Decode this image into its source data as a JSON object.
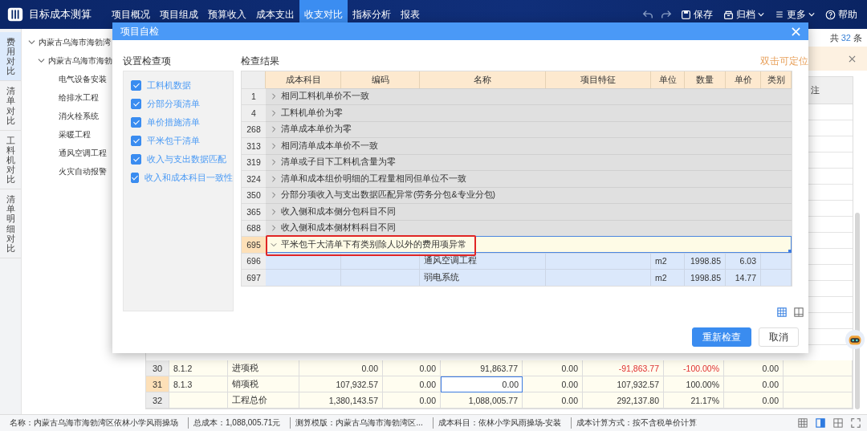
{
  "app_bar": {
    "title": "目标成本测算",
    "nav": [
      {
        "label": "项目概况",
        "selected": false
      },
      {
        "label": "项目组成",
        "selected": false
      },
      {
        "label": "预算收入",
        "selected": false
      },
      {
        "label": "成本支出",
        "selected": false
      },
      {
        "label": "收支对比",
        "selected": true
      },
      {
        "label": "指标分析",
        "selected": false
      },
      {
        "label": "报表",
        "selected": false
      }
    ],
    "actions": [
      {
        "kind": "save",
        "label": "保存",
        "dropdown": false
      },
      {
        "kind": "archive",
        "label": "归档",
        "dropdown": true
      },
      {
        "kind": "more",
        "label": "更多",
        "dropdown": true
      },
      {
        "kind": "help",
        "label": "帮助",
        "dropdown": false
      }
    ]
  },
  "side_tabs": [
    {
      "label": "费用对比",
      "selected": true
    },
    {
      "label": "清单对比",
      "selected": false
    },
    {
      "label": "工料机对比",
      "selected": false
    },
    {
      "label": "清单明细对比",
      "selected": false
    }
  ],
  "tree": [
    {
      "label": "内蒙古乌海市海勃湾",
      "expanded": true,
      "children": [
        {
          "label": "内蒙古乌海市海勃",
          "expanded": true,
          "children": [
            {
              "label": "电气设备安装"
            },
            {
              "label": "给排水工程"
            },
            {
              "label": "消火栓系统"
            },
            {
              "label": "采暖工程"
            },
            {
              "label": "通风空调工程"
            },
            {
              "label": "火灾自动报警"
            }
          ]
        }
      ]
    }
  ],
  "list_summary": {
    "prefix": "共",
    "count": "32",
    "suffix": "条"
  },
  "main_table": {
    "remark_header": "注",
    "rows": [
      {
        "number": "30",
        "selected": false,
        "negative": true,
        "cells": [
          {
            "text": "8.1.2",
            "selected": false
          },
          {
            "text": "进项税",
            "selected": false
          },
          {
            "text": "0.00",
            "selected": false
          },
          {
            "text": "0.00",
            "selected": false
          },
          {
            "text": "91,863.77",
            "selected": false
          },
          {
            "text": "0.00",
            "selected": false
          },
          {
            "text": "-91,863.77",
            "selected": false
          },
          {
            "text": "-100.00%",
            "selected": false
          },
          {
            "text": "0.00",
            "selected": false
          }
        ]
      },
      {
        "number": "31",
        "selected": true,
        "negative": false,
        "cells": [
          {
            "text": "8.1.3",
            "selected": false
          },
          {
            "text": "销项税",
            "selected": false
          },
          {
            "text": "107,932.57",
            "selected": false
          },
          {
            "text": "0.00",
            "selected": false
          },
          {
            "text": "0.00",
            "selected": true
          },
          {
            "text": "0.00",
            "selected": false
          },
          {
            "text": "107,932.57",
            "selected": false
          },
          {
            "text": "100.00%",
            "selected": false
          },
          {
            "text": "0.00",
            "selected": false
          }
        ]
      },
      {
        "number": "32",
        "selected": false,
        "negative": false,
        "cells": [
          {
            "text": "",
            "selected": false
          },
          {
            "text": "工程总价",
            "selected": false
          },
          {
            "text": "1,380,143.57",
            "selected": false
          },
          {
            "text": "0.00",
            "selected": false
          },
          {
            "text": "1,088,005.77",
            "selected": false
          },
          {
            "text": "0.00",
            "selected": false
          },
          {
            "text": "292,137.80",
            "selected": false
          },
          {
            "text": "21.17%",
            "selected": false
          },
          {
            "text": "0.00",
            "selected": false
          }
        ]
      }
    ]
  },
  "status_bar": [
    "名称：内蒙古乌海市海勃湾区依林小学风雨操场",
    "总成本：1,088,005.71元",
    "测算模版：内蒙古乌海市海勃湾区...",
    "成本科目：依林小学风雨操场-安装",
    "成本计算方式：按不含税单价计算"
  ],
  "dialog": {
    "title": "项目自检",
    "settings_title": "设置检查项",
    "checks": [
      {
        "label": "工料机数据",
        "checked": true
      },
      {
        "label": "分部分项清单",
        "checked": true
      },
      {
        "label": "单价措施清单",
        "checked": true
      },
      {
        "label": "平米包干清单",
        "checked": true
      },
      {
        "label": "收入与支出数据匹配",
        "checked": true
      },
      {
        "label": "收入和成本科目一致性",
        "checked": true
      }
    ],
    "results_title": "检查结果",
    "hint": "双击可定位",
    "columns": [
      "成本科目",
      "编码",
      "名称",
      "项目特征",
      "单位",
      "数量",
      "单价",
      "类别"
    ],
    "rows": [
      {
        "kind": "group",
        "number": "1",
        "label": "相同工料机单价不一致",
        "expanded": false,
        "selected": false,
        "annotated": false
      },
      {
        "kind": "group",
        "number": "4",
        "label": "工料机单价为零",
        "expanded": false,
        "selected": false,
        "annotated": false
      },
      {
        "kind": "group",
        "number": "268",
        "label": "清单成本单价为零",
        "expanded": false,
        "selected": false,
        "annotated": false
      },
      {
        "kind": "group",
        "number": "313",
        "label": "相同清单成本单价不一致",
        "expanded": false,
        "selected": false,
        "annotated": false
      },
      {
        "kind": "group",
        "number": "319",
        "label": "清单或子目下工料机含量为零",
        "expanded": false,
        "selected": false,
        "annotated": false
      },
      {
        "kind": "group",
        "number": "324",
        "label": "清单和成本组价明细的工程量相同但单位不一致",
        "expanded": false,
        "selected": false,
        "annotated": false
      },
      {
        "kind": "group",
        "number": "350",
        "label": "分部分项收入与支出数据匹配异常(劳务分包&专业分包)",
        "expanded": false,
        "selected": false,
        "annotated": false
      },
      {
        "kind": "group",
        "number": "365",
        "label": "收入侧和成本侧分包科目不同",
        "expanded": false,
        "selected": false,
        "annotated": false
      },
      {
        "kind": "group",
        "number": "688",
        "label": "收入侧和成本侧材料科目不同",
        "expanded": false,
        "selected": false,
        "annotated": false
      },
      {
        "kind": "group",
        "number": "695",
        "label": "平米包干大清单下有类别除人以外的费用项异常",
        "expanded": true,
        "selected": true,
        "annotated": true
      },
      {
        "kind": "item",
        "number": "696",
        "cells": [
          "",
          "",
          "通风空调工程",
          "",
          "m2",
          "1998.85",
          "6.03",
          ""
        ]
      },
      {
        "kind": "item",
        "number": "697",
        "cells": [
          "",
          "",
          "弱电系统",
          "",
          "m2",
          "1998.85",
          "14.77",
          ""
        ]
      }
    ],
    "buttons": [
      {
        "label": "重新检查",
        "kind": "primary"
      },
      {
        "label": "取消",
        "kind": "default"
      }
    ]
  }
}
